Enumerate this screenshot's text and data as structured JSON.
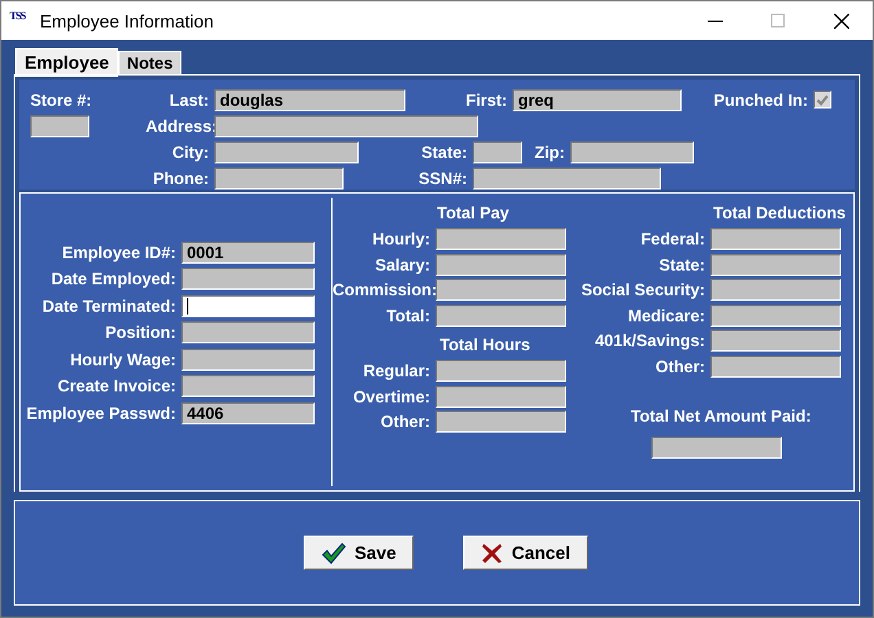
{
  "window": {
    "title": "Employee Information",
    "icon_label": "TSS"
  },
  "tabs": [
    {
      "label": "Employee",
      "selected": true
    },
    {
      "label": "Notes",
      "selected": false
    }
  ],
  "top": {
    "store": {
      "label": "Store #:"
    },
    "last": {
      "label": "Last:",
      "value": "douglas"
    },
    "first": {
      "label": "First:",
      "value": "greq"
    },
    "punched_in": {
      "label": "Punched In:",
      "checked": true
    },
    "address": {
      "label": "Address:"
    },
    "city": {
      "label": "City:"
    },
    "state": {
      "label": "State:"
    },
    "zip": {
      "label": "Zip:"
    },
    "phone": {
      "label": "Phone:"
    },
    "ssn": {
      "label": "SSN#:"
    }
  },
  "employee_fields": [
    {
      "label": "Employee ID#:",
      "value": "0001",
      "focused": false
    },
    {
      "label": "Date Employed:",
      "focused": false
    },
    {
      "label": "Date Terminated:",
      "focused": true
    },
    {
      "label": "Position:",
      "focused": false
    },
    {
      "label": "Hourly Wage:",
      "focused": false
    },
    {
      "label": "Create Invoice:",
      "focused": false
    },
    {
      "label": "Employee Passwd:",
      "value": "4406",
      "focused": false
    }
  ],
  "total_pay": {
    "title": "Total Pay",
    "fields": [
      {
        "label": "Hourly:"
      },
      {
        "label": "Salary:"
      },
      {
        "label": "Commission:"
      },
      {
        "label": "Total:"
      }
    ]
  },
  "total_hours": {
    "title": "Total Hours",
    "fields": [
      {
        "label": "Regular:"
      },
      {
        "label": "Overtime:"
      },
      {
        "label": "Other:"
      }
    ]
  },
  "total_deductions": {
    "title": "Total Deductions",
    "fields": [
      {
        "label": "Federal:"
      },
      {
        "label": "State:"
      },
      {
        "label": "Social Security:"
      },
      {
        "label": "Medicare:"
      },
      {
        "label": "401k/Savings:"
      },
      {
        "label": "Other:"
      }
    ]
  },
  "net": {
    "label": "Total Net Amount Paid:"
  },
  "buttons": [
    {
      "kind": "save",
      "label": "Save"
    },
    {
      "kind": "cancel",
      "label": "Cancel"
    }
  ]
}
